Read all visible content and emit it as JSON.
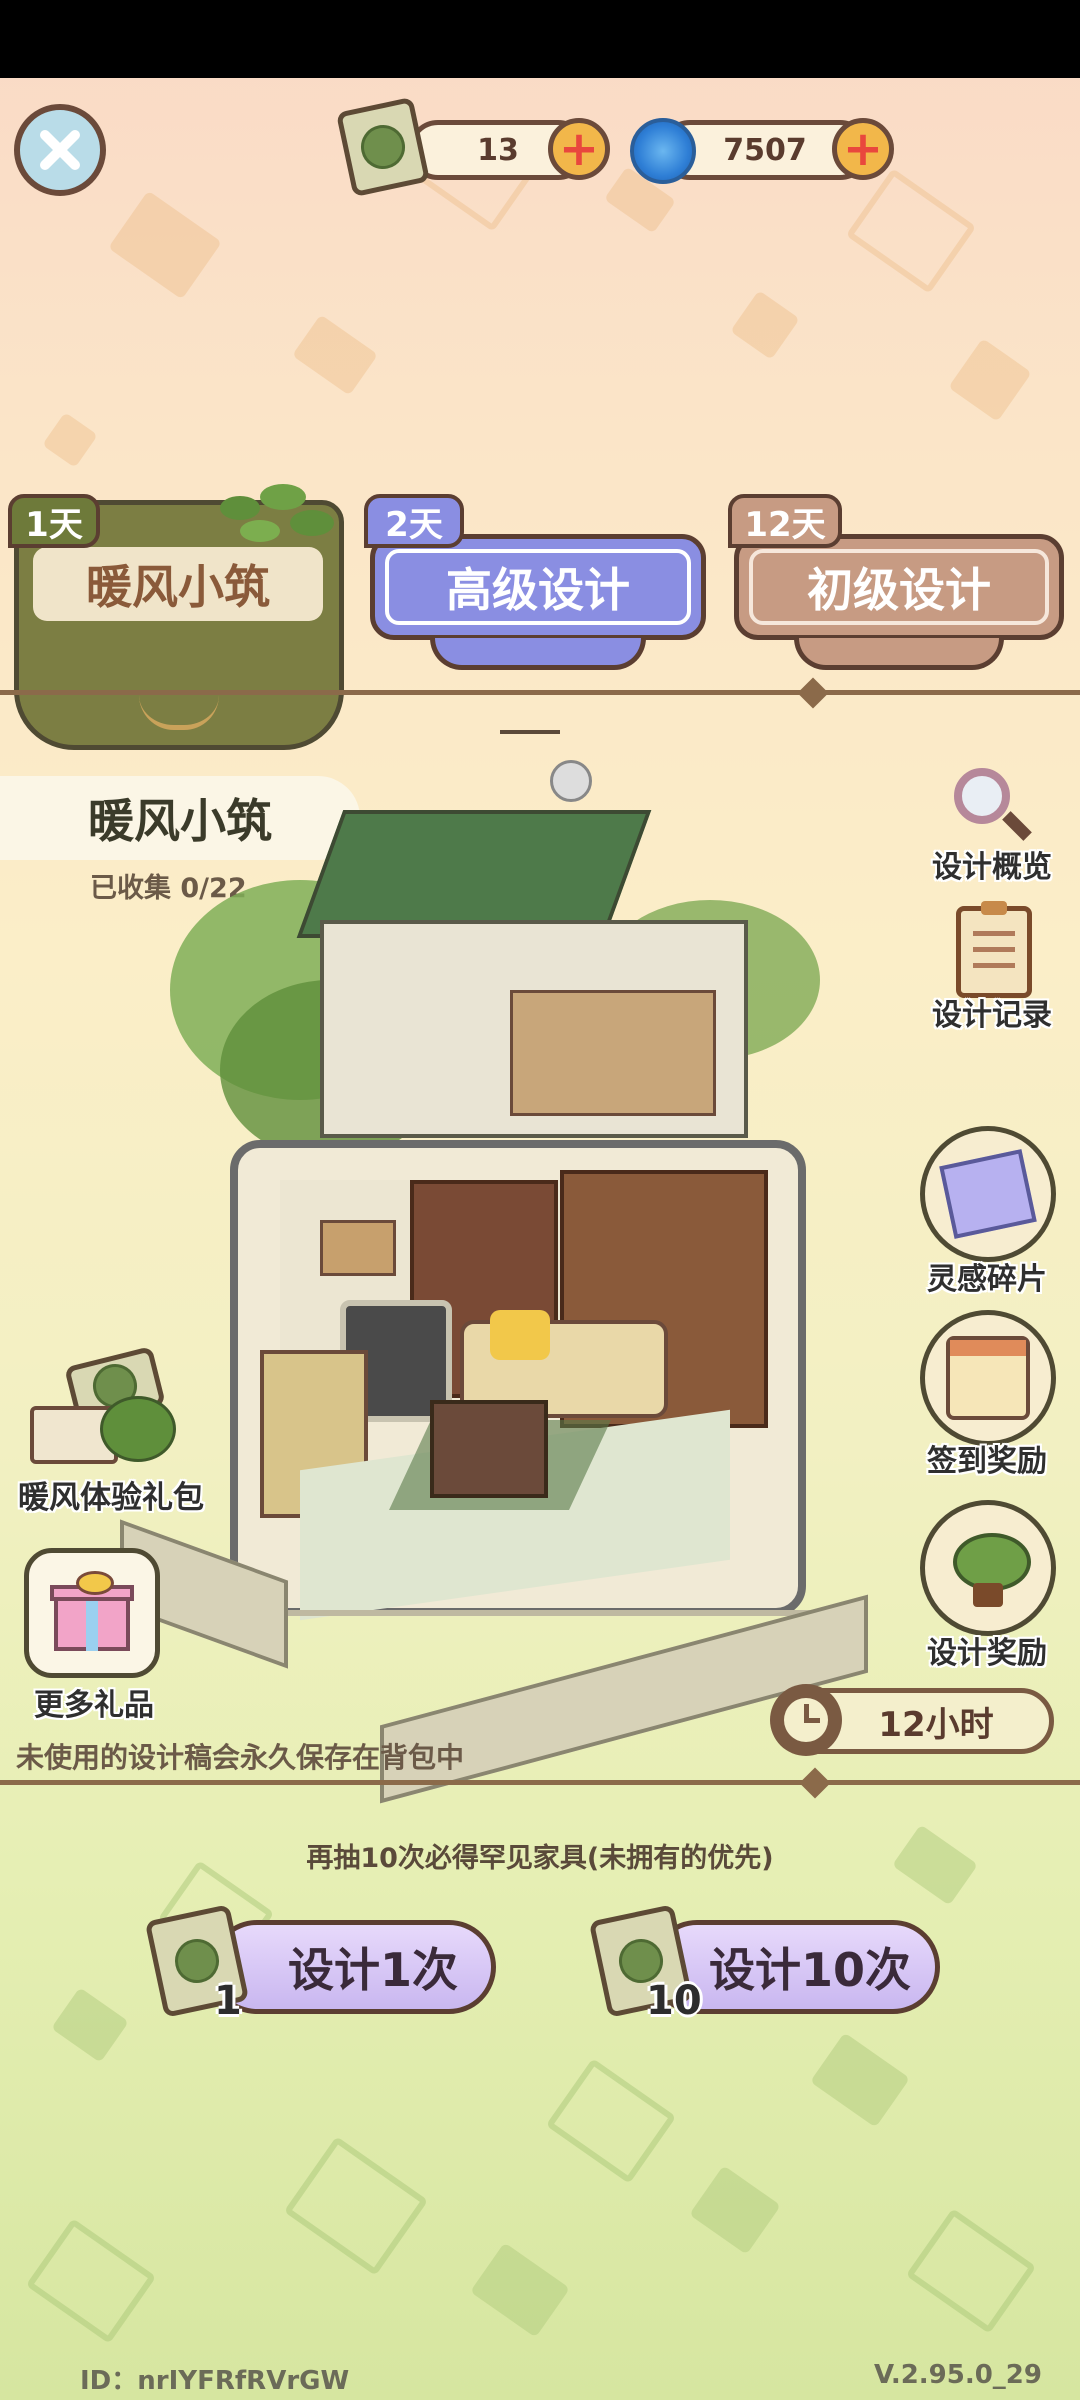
{
  "top_bar": {
    "close_icon": "close-icon",
    "scrolls": {
      "icon": "design-scroll-icon",
      "count": "13"
    },
    "inspiration": {
      "icon": "spiral-icon",
      "count": "7507"
    }
  },
  "tabs": [
    {
      "days": "1天",
      "label": "暖风小筑",
      "active": true,
      "color": "#6f7a3f"
    },
    {
      "days": "2天",
      "label": "高级设计",
      "active": false,
      "color": "#8a8ee2"
    },
    {
      "days": "12天",
      "label": "初级设计",
      "active": false,
      "color": "#c79b83"
    }
  ],
  "house": {
    "name": "暖风小筑",
    "collected": "已收集 0/22"
  },
  "right_features": [
    {
      "label": "设计概览",
      "icon": "magnifier-icon"
    },
    {
      "label": "设计记录",
      "icon": "clipboard-icon"
    },
    {
      "label": "灵感碎片",
      "icon": "map-fragment-icon"
    },
    {
      "label": "签到奖励",
      "icon": "calendar-icon"
    },
    {
      "label": "设计奖励",
      "icon": "plant-icon"
    }
  ],
  "left_features": [
    {
      "label": "暖风体验礼包",
      "icon": "gift-pack-icon"
    },
    {
      "label": "更多礼品",
      "icon": "gift-box-icon"
    }
  ],
  "timer": "12小时",
  "save_note": "未使用的设计稿会永久保存在背包中",
  "guarantee": "再抽10次必得罕见家具(未拥有的优先)",
  "draw_buttons": [
    {
      "label": "设计1次",
      "cost": "1"
    },
    {
      "label": "设计10次",
      "cost": "10"
    }
  ],
  "footer": {
    "id": "ID：nrIYFRfRVrGW",
    "version": "V.2.95.0_29"
  }
}
